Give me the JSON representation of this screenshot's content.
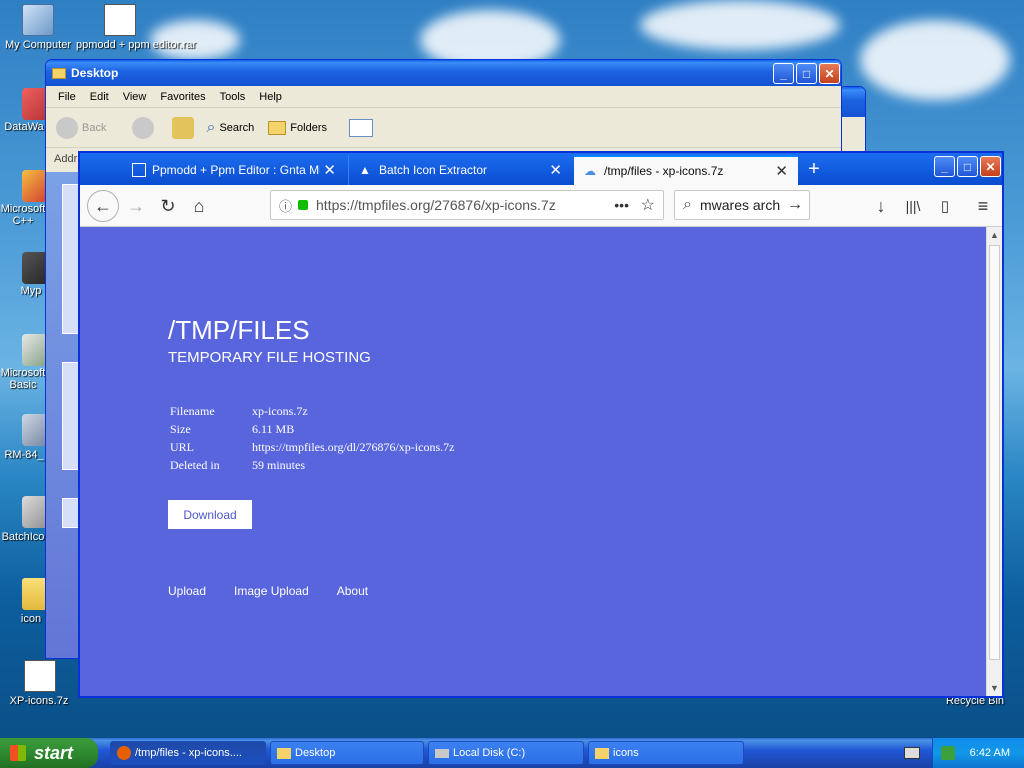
{
  "desktop": {
    "icons": [
      {
        "label": "My Computer"
      },
      {
        "label": "ppmodd + ppm editor.rar"
      },
      {
        "label": "DataWa"
      },
      {
        "label": "Microsoft C++"
      },
      {
        "label": "Myp"
      },
      {
        "label": "Microsoft Basic"
      },
      {
        "label": "RM-84_"
      },
      {
        "label": "BatchIco"
      },
      {
        "label": "icon"
      },
      {
        "label": "XP-icons.7z"
      },
      {
        "label": "Recycle Bin"
      }
    ]
  },
  "explorer": {
    "title": "Desktop",
    "menu": [
      "File",
      "Edit",
      "View",
      "Favorites",
      "Tools",
      "Help"
    ],
    "toolbar": {
      "back": "Back",
      "search": "Search",
      "folders": "Folders"
    },
    "address_label": "Addr"
  },
  "firefox": {
    "tabs": [
      {
        "label": "Ppmodd + Ppm Editor : Gnta Muza"
      },
      {
        "label": "Batch Icon Extractor"
      },
      {
        "label": "/tmp/files - xp-icons.7z"
      }
    ],
    "url": "https://tmpfiles.org/276876/xp-icons.7z",
    "search_value": "mwares arch",
    "page": {
      "title": "/TMP/FILES",
      "subtitle": "TEMPORARY FILE HOSTING",
      "details": [
        {
          "label": "Filename",
          "value": "xp-icons.7z"
        },
        {
          "label": "Size",
          "value": "6.11 MB"
        },
        {
          "label": "URL",
          "value": "https://tmpfiles.org/dl/276876/xp-icons.7z"
        },
        {
          "label": "Deleted in",
          "value": "59 minutes"
        }
      ],
      "download_label": "Download",
      "footer_links": [
        "Upload",
        "Image Upload",
        "About"
      ]
    }
  },
  "taskbar": {
    "start_label": "start",
    "buttons": [
      {
        "label": "/tmp/files - xp-icons...."
      },
      {
        "label": "Desktop"
      },
      {
        "label": "Local Disk (C:)"
      },
      {
        "label": "icons"
      }
    ],
    "clock": "6:42 AM"
  }
}
